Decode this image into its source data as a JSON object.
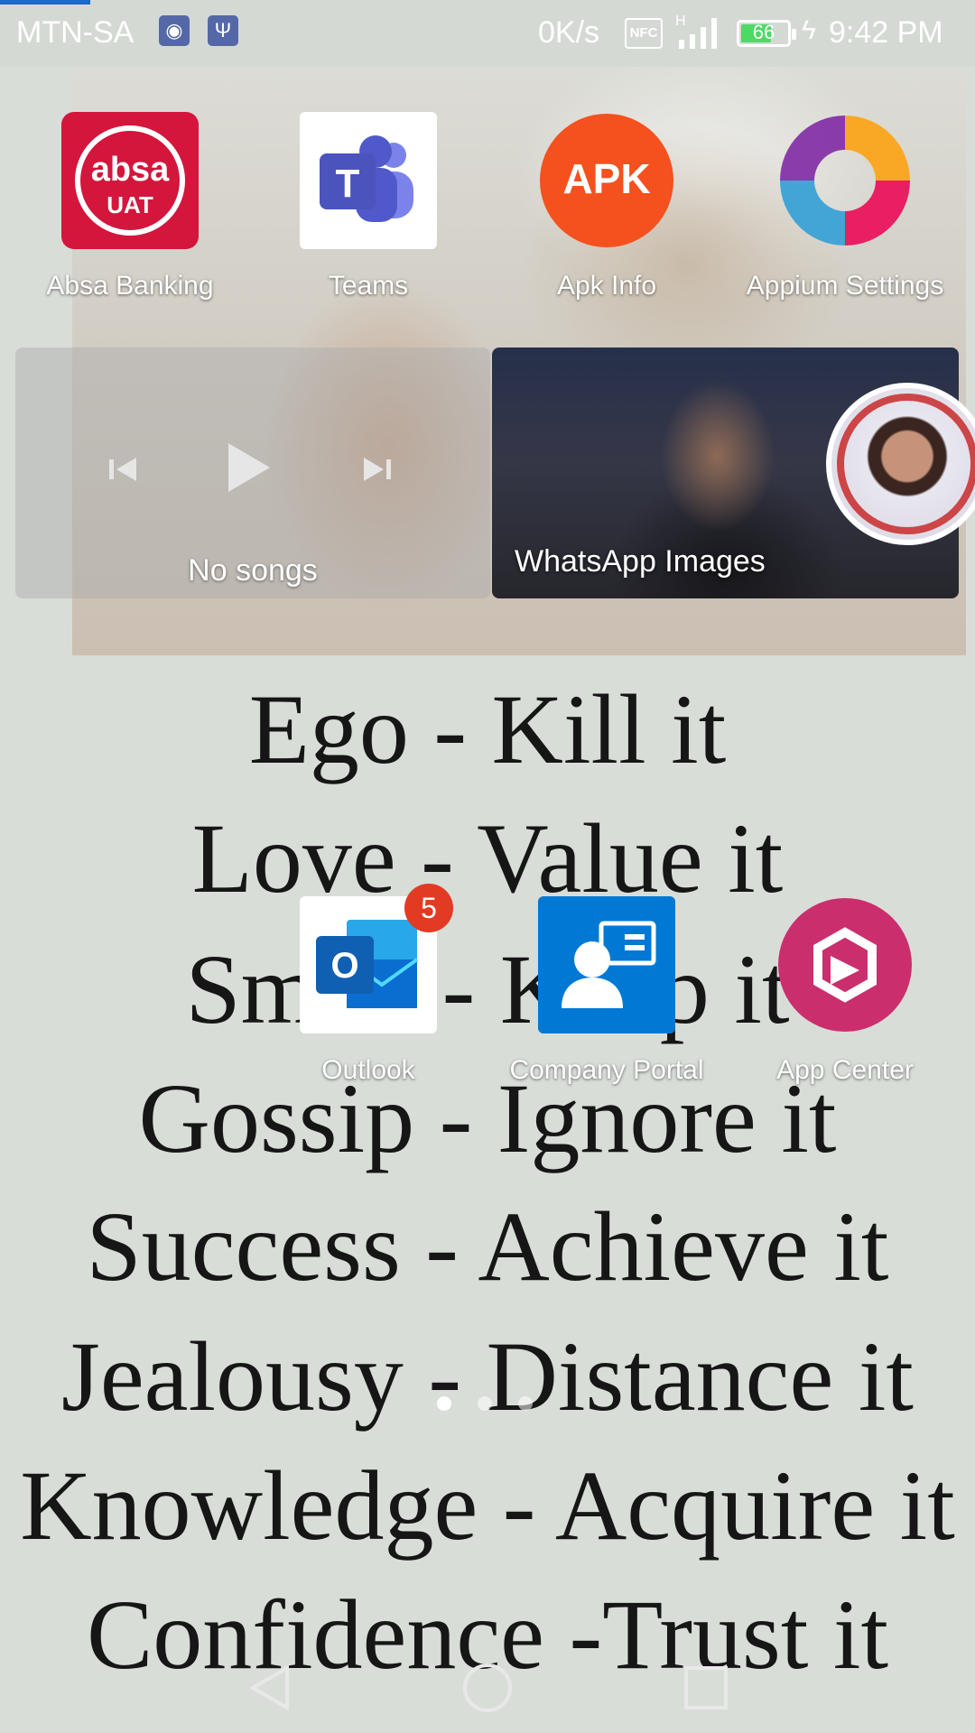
{
  "status_bar": {
    "carrier": "MTN-SA",
    "net_speed": "0K/s",
    "nfc": "NFC",
    "network_type": "H",
    "battery_level": "66",
    "battery_fraction": 0.66,
    "time": "9:42 PM",
    "icons": [
      "eye-notification-icon",
      "usb-icon",
      "nfc-icon",
      "signal-icon",
      "battery-icon",
      "charging-icon"
    ]
  },
  "wallpaper": {
    "quote_lines": [
      "Ego - Kill it",
      "Love - Value it",
      "Smile - Keep it",
      "Gossip - Ignore it",
      "Success - Achieve it",
      "Jealousy - Distance it",
      "Knowledge - Acquire it",
      "Confidence -Trust it"
    ]
  },
  "apps_row1": [
    {
      "label": "Absa Banking",
      "icon": "absa-banking-icon",
      "icon_text": "absa",
      "icon_subtext": "UAT",
      "color": "#d4163c"
    },
    {
      "label": "Teams",
      "icon": "teams-icon",
      "icon_text": "T",
      "color": "#5059c9"
    },
    {
      "label": "Apk Info",
      "icon": "apk-info-icon",
      "icon_text": "APK",
      "color": "#f4511e"
    },
    {
      "label": "Appium Settings",
      "icon": "appium-settings-icon",
      "icon_text": "",
      "color": "#e91e63"
    }
  ],
  "music_widget": {
    "status": "No songs",
    "controls": [
      "previous-icon",
      "play-icon",
      "next-icon"
    ]
  },
  "gallery_widget": {
    "label": "WhatsApp Images"
  },
  "apps_row2": [
    {
      "label": "Outlook",
      "icon": "outlook-icon",
      "icon_text": "O",
      "badge": "5",
      "color": "#0078d4"
    },
    {
      "label": "Company Portal",
      "icon": "company-portal-icon",
      "icon_text": "",
      "color": "#0078d4"
    },
    {
      "label": "App Center",
      "icon": "app-center-icon",
      "icon_text": "",
      "color": "#cb2e6d"
    }
  ],
  "pager": {
    "pages": 3,
    "current": 1
  },
  "nav_bar": {
    "buttons": [
      "back-icon",
      "home-icon",
      "recents-icon"
    ]
  }
}
